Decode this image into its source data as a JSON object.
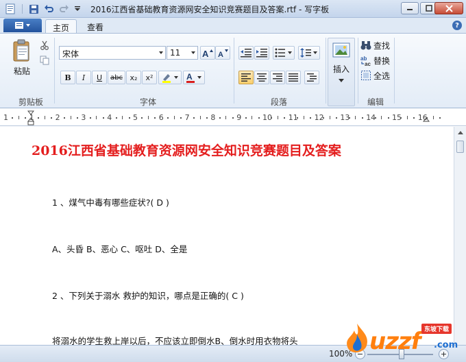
{
  "titlebar": {
    "title": "2016江西省基础教育资源网安全知识竞赛题目及答案.rtf - 写字板"
  },
  "tabs": {
    "home": "主页",
    "view": "查看",
    "help": "?"
  },
  "ribbon": {
    "clipboard": {
      "paste": "粘贴",
      "label": "剪贴板"
    },
    "font": {
      "family": "宋体",
      "size": "11",
      "label": "字体",
      "bold": "B",
      "italic": "I",
      "underline": "U",
      "strike": "abc",
      "subscript": "x₂",
      "superscript": "x²",
      "highlight_color": "#ffff00",
      "text_color": "#d81e1e"
    },
    "paragraph": {
      "label": "段落"
    },
    "insert": {
      "label": "插入"
    },
    "editing": {
      "find": "查找",
      "replace": "替换",
      "select_all": "全选",
      "label": "编辑"
    }
  },
  "ruler": {
    "numbers": [
      "1",
      "1",
      "2",
      "3",
      "4",
      "5",
      "6",
      "7",
      "8",
      "9",
      "10",
      "11",
      "12",
      "13",
      "14",
      "15",
      "16"
    ]
  },
  "document": {
    "title": "2016江西省基础教育资源网安全知识竞赛题目及答案",
    "title_color": "#e41e1e",
    "lines": [
      "1 、煤气中毒有哪些症状?( D )",
      "A、头昏 B、恶心 C、呕吐 D、全是",
      "2 、下列关于溺水 救护的知识，哪点是正确的( C )",
      "将溺水的学生救上岸以后，不应该立即倒水B、倒水时用衣物将头"
    ]
  },
  "statusbar": {
    "zoom": "100%",
    "zoom_minus": "−",
    "zoom_plus": "+"
  },
  "watermark": {
    "brand": "uzzf",
    "badge": "东坡下载",
    "suffix": ".com"
  }
}
